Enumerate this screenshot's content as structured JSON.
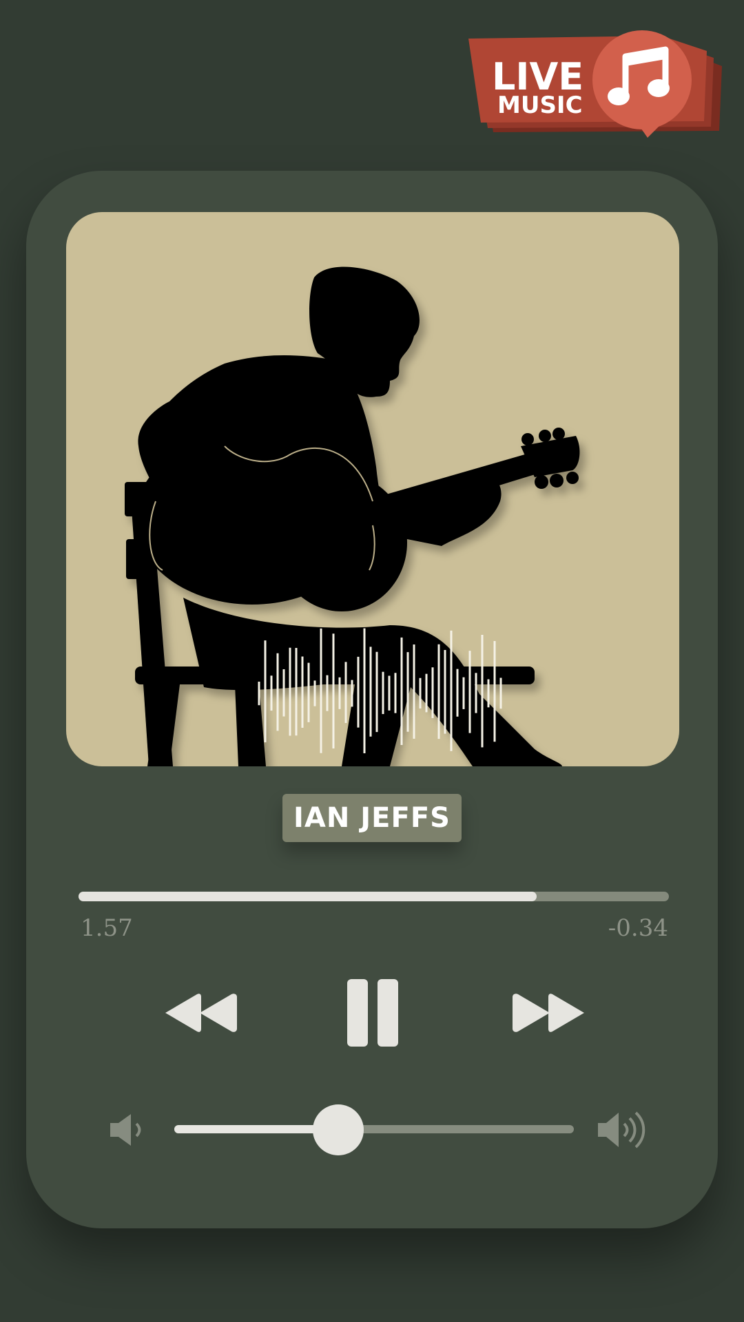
{
  "badge": {
    "line1": "LIVE",
    "line2": "MUSIC",
    "icon": "music-note-icon"
  },
  "track": {
    "artist": "IAN JEFFS"
  },
  "playback": {
    "elapsed": "1.57",
    "remaining": "-0.34",
    "progress": 0.776,
    "state": "playing"
  },
  "volume": {
    "level": 0.41
  },
  "colors": {
    "background": "#323c33",
    "card": "#414c40",
    "artwork": "#cbbf98",
    "badge": "#b34c39",
    "controls": "#e6e5e0"
  }
}
